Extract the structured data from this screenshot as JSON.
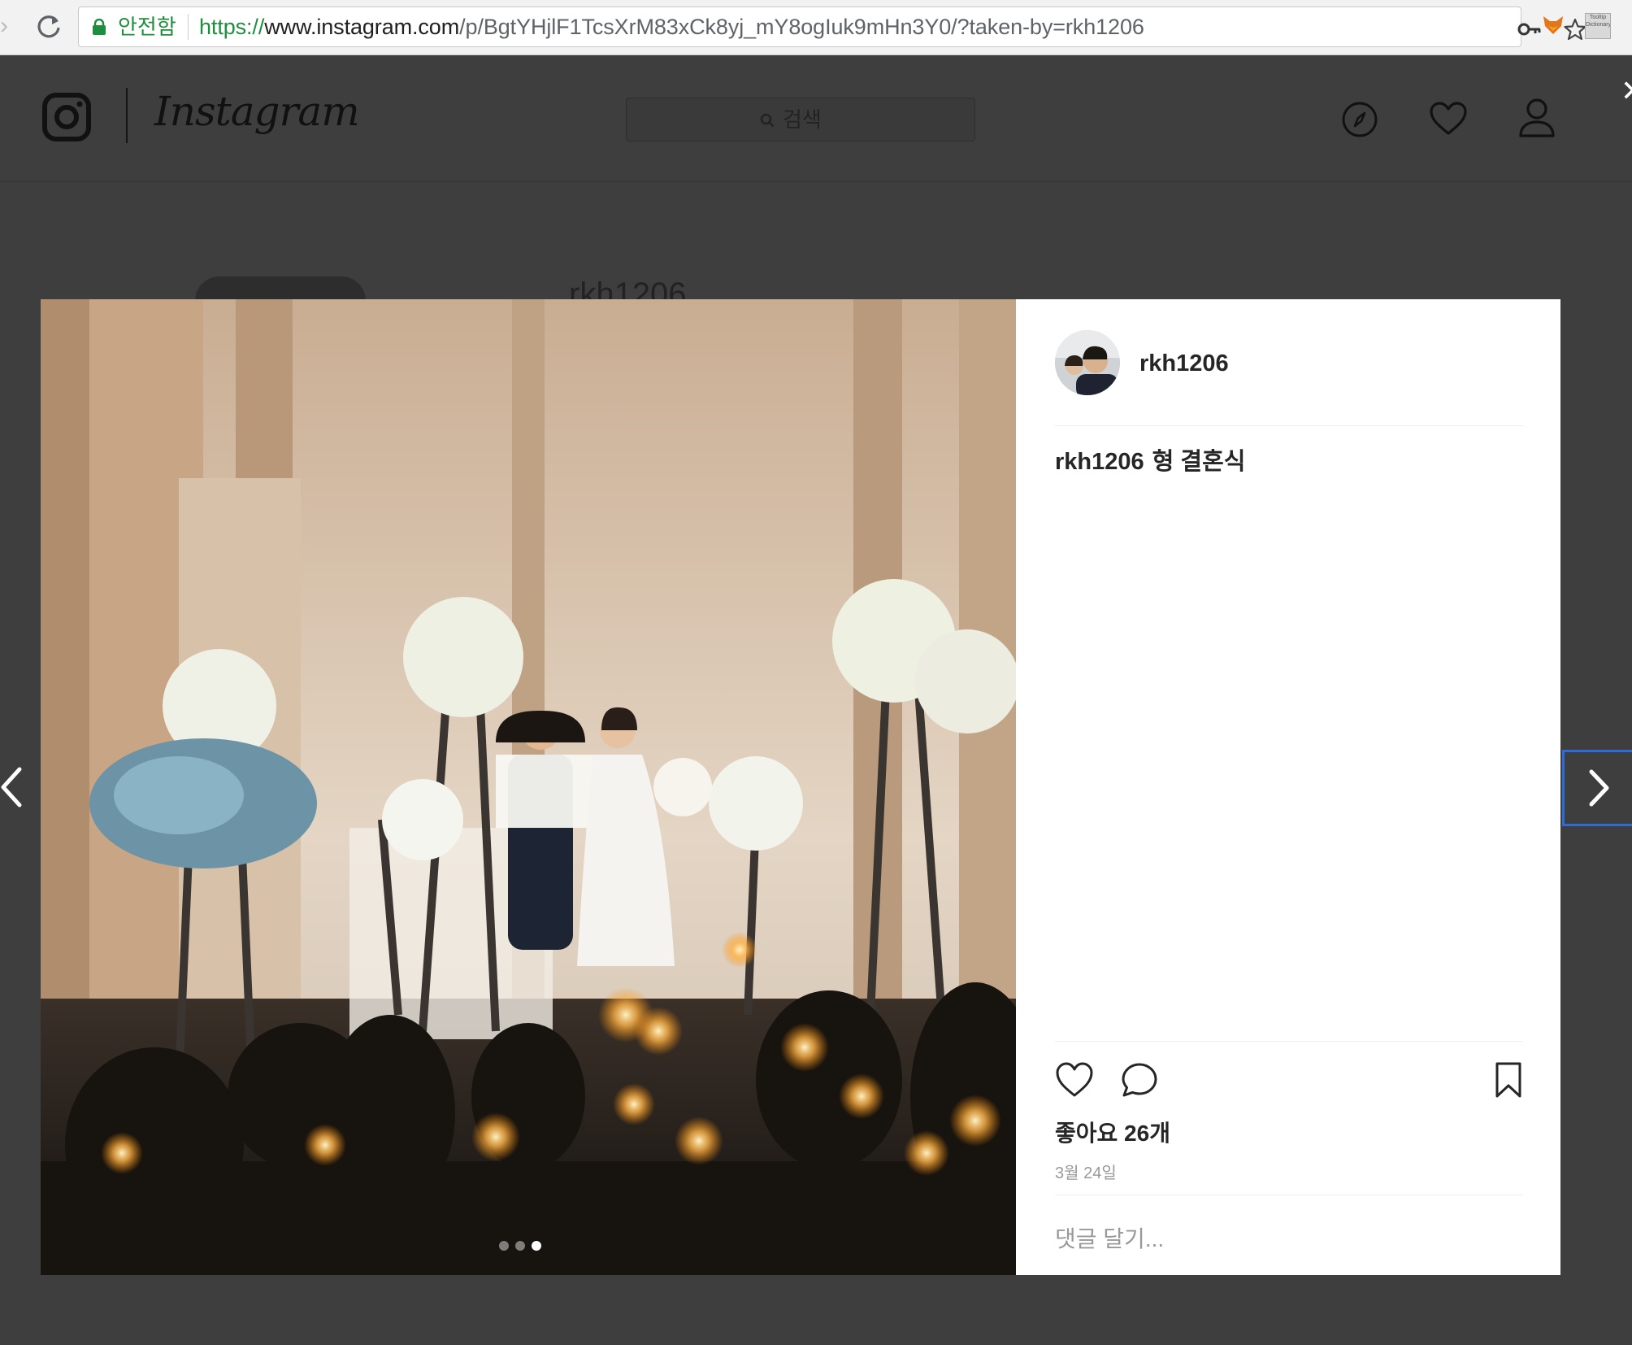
{
  "browser": {
    "secure_label": "안전함",
    "url_protocol": "https://",
    "url_host": "www.instagram.com",
    "url_path": "/p/BgtYHjlF1TcsXrM83xCk8yj_mY8ogIuk9mHn3Y0/?taken-by=rkh1206",
    "extension_tooltip_text": "Tooltip Dictionary"
  },
  "header": {
    "wordmark": "Instagram",
    "search_placeholder": "검색"
  },
  "background_profile": {
    "username_partial": "rkh1206"
  },
  "post": {
    "username": "rkh1206",
    "caption_user": "rkh1206",
    "caption_text": "형 결혼식",
    "likes": "좋아요 26개",
    "date": "3월 24일",
    "comment_placeholder": "댓글 달기...",
    "carousel": {
      "count": 3,
      "active_index": 2
    }
  },
  "colors": {
    "overlay_bg": "#3e3e3e",
    "secure_green": "#1e8e3e",
    "focus_blue": "#2d6bd8",
    "text_primary": "#262626",
    "text_secondary": "#999999"
  },
  "icons": [
    "reload-icon",
    "lock-icon",
    "key-icon",
    "star-icon",
    "fox-extension-icon",
    "instagram-camera-icon",
    "search-icon",
    "compass-icon",
    "heart-icon",
    "profile-icon",
    "like-icon",
    "comment-icon",
    "bookmark-icon",
    "chevron-left-icon",
    "chevron-right-icon"
  ]
}
